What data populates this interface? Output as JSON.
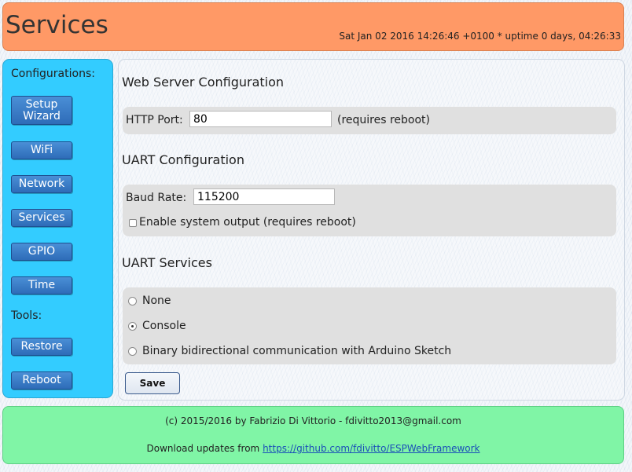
{
  "header": {
    "title": "Services",
    "status": "Sat Jan 02 2016 14:26:46 +0100 * uptime 0 days, 04:26:33"
  },
  "sidebar": {
    "configurations_label": "Configurations:",
    "tools_label": "Tools:",
    "items": [
      {
        "label": "Setup Wizard"
      },
      {
        "label": "WiFi"
      },
      {
        "label": "Network"
      },
      {
        "label": "Services"
      },
      {
        "label": "GPIO"
      },
      {
        "label": "Time"
      }
    ],
    "tools": [
      {
        "label": "Restore"
      },
      {
        "label": "Reboot"
      }
    ]
  },
  "main": {
    "web_server": {
      "title": "Web Server Configuration",
      "http_port_label": "HTTP Port:",
      "http_port_value": "80",
      "http_port_note": "(requires reboot)"
    },
    "uart": {
      "title": "UART Configuration",
      "baud_rate_label": "Baud Rate:",
      "baud_rate_value": "115200",
      "system_output_label": "Enable system output (requires reboot)",
      "system_output_checked": false
    },
    "uart_services": {
      "title": "UART Services",
      "options": [
        {
          "label": "None",
          "selected": false
        },
        {
          "label": "Console",
          "selected": true
        },
        {
          "label": "Binary bidirectional communication with Arduino Sketch",
          "selected": false
        }
      ]
    },
    "save_label": "Save"
  },
  "footer": {
    "copyright": "(c) 2015/2016 by Fabrizio Di Vittorio - fdivitto2013@gmail.com",
    "download_prefix": "Download updates from",
    "download_link": "https://github.com/fdivitto/ESPWebFramework"
  }
}
